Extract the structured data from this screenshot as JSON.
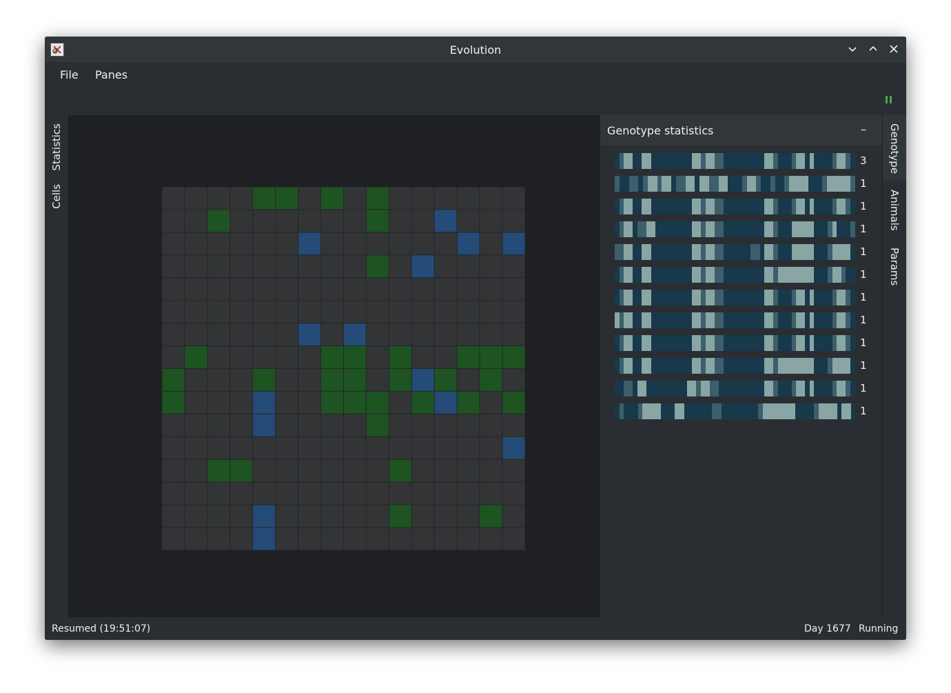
{
  "window": {
    "title": "Evolution"
  },
  "menu": {
    "file": "File",
    "panes": "Panes"
  },
  "left_tabs": {
    "statistics": "Statistics",
    "cells": "Cells"
  },
  "right_tabs": {
    "genotype": "Genotype",
    "animals": "Animals",
    "params": "Params"
  },
  "panel": {
    "title": "Genotype statistics",
    "collapse": "–"
  },
  "genotypes": [
    {
      "count": "3",
      "pattern": "ABCCAACCAAAAAAAAACCBCCBBAAAAAAAAACCBAAABCCACAAAABCCBA"
    },
    {
      "count": "1",
      "pattern": "BAABBABCCBCCABBCCACCBBCCAAABCCBAABAABCCCCAAABCCCCCB"
    },
    {
      "count": "1",
      "pattern": "ABCCAACCAAAAAAAAACCBCCBBAAAAAAAAACCBAAABCCACAAAABCCBA"
    },
    {
      "count": "1",
      "pattern": "ABCCABBCCAAAAAAAACCBCCBBAAAAAAAAACCBAAACCCCCAAABCAAAB"
    },
    {
      "count": "1",
      "pattern": "BBCCAACCAAAAAAAAACCBCCBBAAAAAABBACCBAAACCCCCAAABCCCCA"
    },
    {
      "count": "1",
      "pattern": "ABCCAACCAAAAAAAAACCBCCBBAAAAAAAAACCBCCCCCCCCAAABCCBAA"
    },
    {
      "count": "1",
      "pattern": "ABCCAACCAAAAAAAAACCBCCBBAAAAAAAAACCBAAABCCACAAAABCCBA"
    },
    {
      "count": "1",
      "pattern": "CBCCAACCAAAAAAAAACCBCCBBAAAAAAAAACCBAAABCCACAAAABCCBA"
    },
    {
      "count": "1",
      "pattern": "ABCCAACCAAAAAAAAACCBCCBBAAAAAAAAACCBAAABCCACAAAABCCBA"
    },
    {
      "count": "1",
      "pattern": "ABCCAACCAAAAAAAAACCBCCBBAAAAAAAAACCBCCCCCCCCAAABCCCCA"
    },
    {
      "count": "1",
      "pattern": "AABBACCAAAAAAAAACCBCCBBAAAAAAAAAACCBAAABCCACAAAABCCBA"
    },
    {
      "count": "1",
      "pattern": "ABAAABCCCCAAACCAAAAAABBAAAAAAAABCCCCCCCAAAABCCCCACCA"
    }
  ],
  "genotype_colors": {
    "A": "#17394b",
    "B": "#3c5f6b",
    "C": "#8aa6a4"
  },
  "grid": {
    "size": 16,
    "colors": {
      "empty": "#323436",
      "green": "#1d5422",
      "blue": "#254b78",
      "line": "#25272a"
    },
    "green_cells": [
      [
        0,
        4
      ],
      [
        0,
        5
      ],
      [
        0,
        7
      ],
      [
        0,
        9
      ],
      [
        1,
        2
      ],
      [
        1,
        9
      ],
      [
        3,
        9
      ],
      [
        7,
        1
      ],
      [
        7,
        7
      ],
      [
        7,
        8
      ],
      [
        7,
        10
      ],
      [
        7,
        13
      ],
      [
        7,
        14
      ],
      [
        7,
        15
      ],
      [
        8,
        0
      ],
      [
        8,
        4
      ],
      [
        8,
        7
      ],
      [
        8,
        8
      ],
      [
        8,
        10
      ],
      [
        8,
        12
      ],
      [
        8,
        14
      ],
      [
        9,
        0
      ],
      [
        9,
        7
      ],
      [
        9,
        8
      ],
      [
        9,
        9
      ],
      [
        9,
        11
      ],
      [
        9,
        13
      ],
      [
        9,
        15
      ],
      [
        10,
        9
      ],
      [
        12,
        2
      ],
      [
        12,
        3
      ],
      [
        12,
        10
      ],
      [
        14,
        10
      ],
      [
        14,
        14
      ]
    ],
    "blue_cells": [
      [
        1,
        12
      ],
      [
        2,
        6
      ],
      [
        2,
        13
      ],
      [
        2,
        15
      ],
      [
        3,
        11
      ],
      [
        6,
        6
      ],
      [
        6,
        8
      ],
      [
        8,
        11
      ],
      [
        9,
        4
      ],
      [
        9,
        12
      ],
      [
        10,
        4
      ],
      [
        11,
        15
      ],
      [
        14,
        4
      ],
      [
        15,
        4
      ]
    ]
  },
  "status": {
    "left": "Resumed (19:51:07)",
    "day": "Day 1677",
    "state": "Running"
  }
}
